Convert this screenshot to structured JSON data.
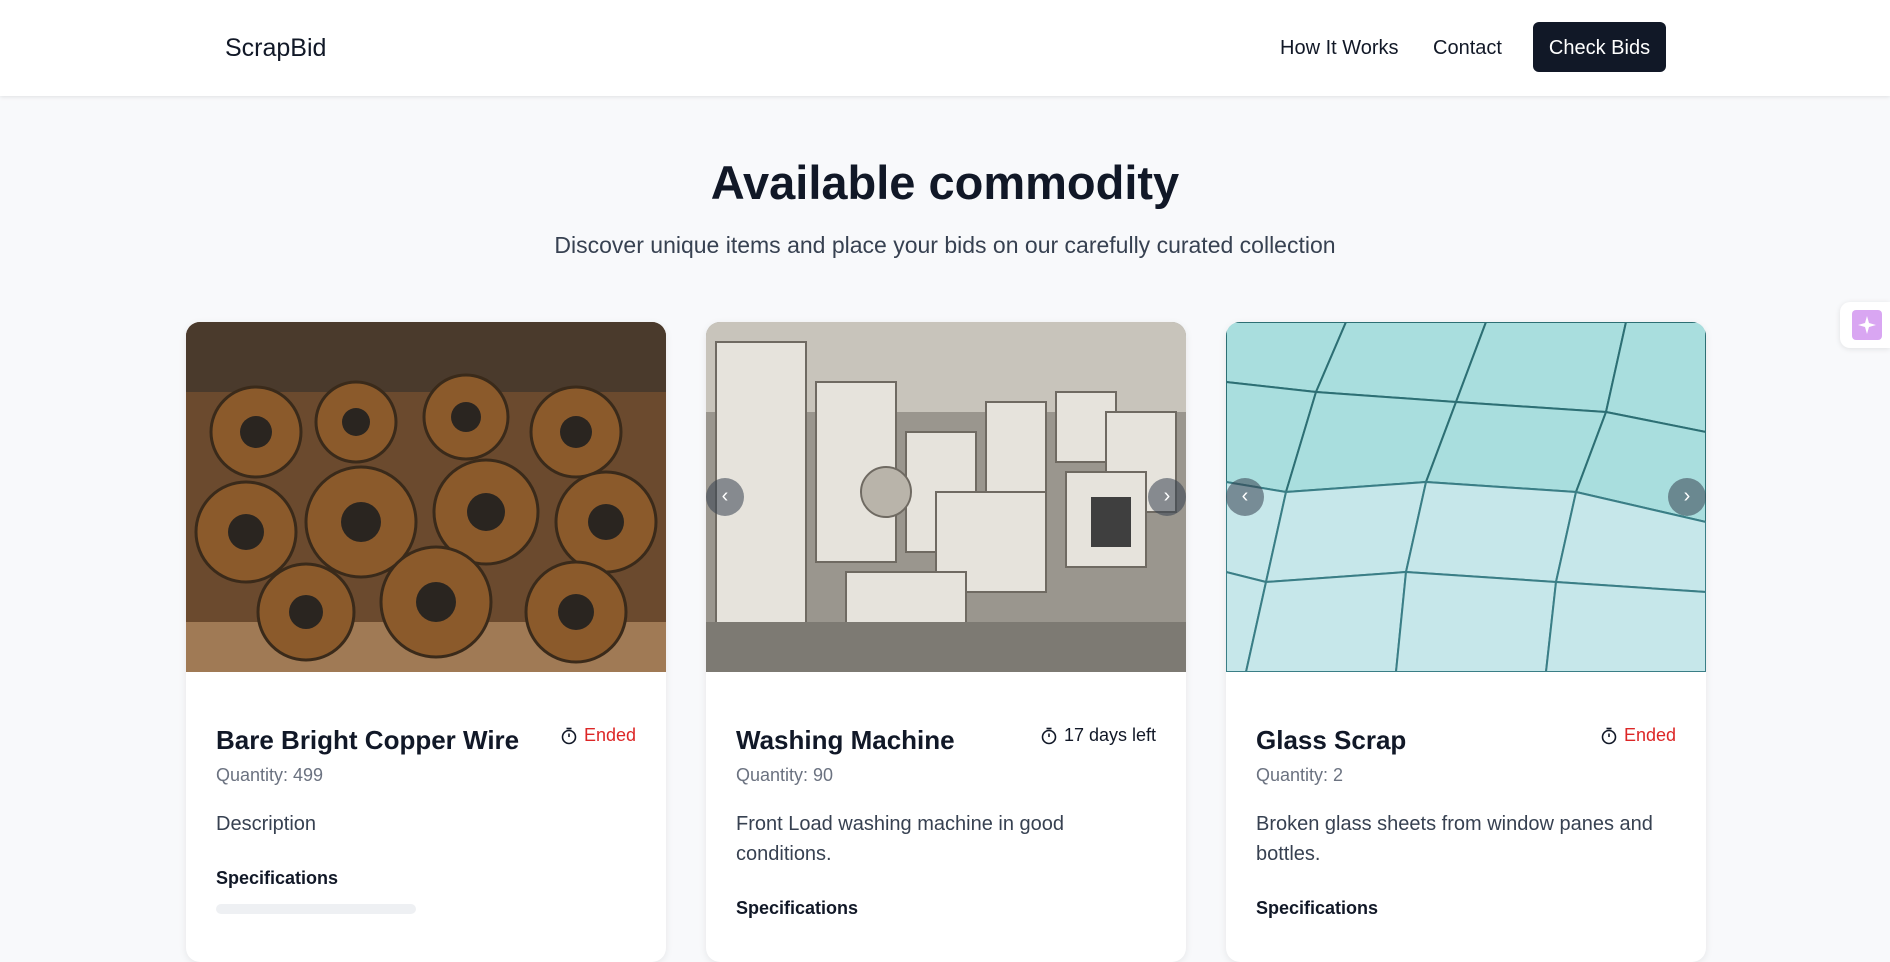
{
  "navbar": {
    "brand": "ScrapBid",
    "links": [
      "How It Works",
      "Contact"
    ],
    "cta": "Check Bids"
  },
  "hero": {
    "title": "Available commodity",
    "subtitle": "Discover unique items and place your bids on our carefully curated collection"
  },
  "cards": [
    {
      "title": "Bare Bright Copper Wire",
      "status": "Ended",
      "quantity": "Quantity: 499",
      "description": "Description",
      "specs_label": "Specifications"
    },
    {
      "title": "Washing Machine",
      "status": "17 days left",
      "quantity": "Quantity: 90",
      "description": "Front Load washing machine in good conditions.",
      "specs_label": "Specifications",
      "carousel_prev": "‹",
      "carousel_next": "›"
    },
    {
      "title": "Glass Scrap",
      "status": "Ended",
      "quantity": "Quantity: 2",
      "description": "Broken glass sheets from window panes and bottles.",
      "specs_label": "Specifications",
      "carousel_prev": "‹",
      "carousel_next": "›"
    }
  ],
  "colors": {
    "ended": "#dc2626",
    "primary_dark": "#111827",
    "assistant_accent": "#d9a6f2"
  },
  "icons": {
    "timer": "stopwatch-icon",
    "assistant": "sparkle-icon"
  }
}
